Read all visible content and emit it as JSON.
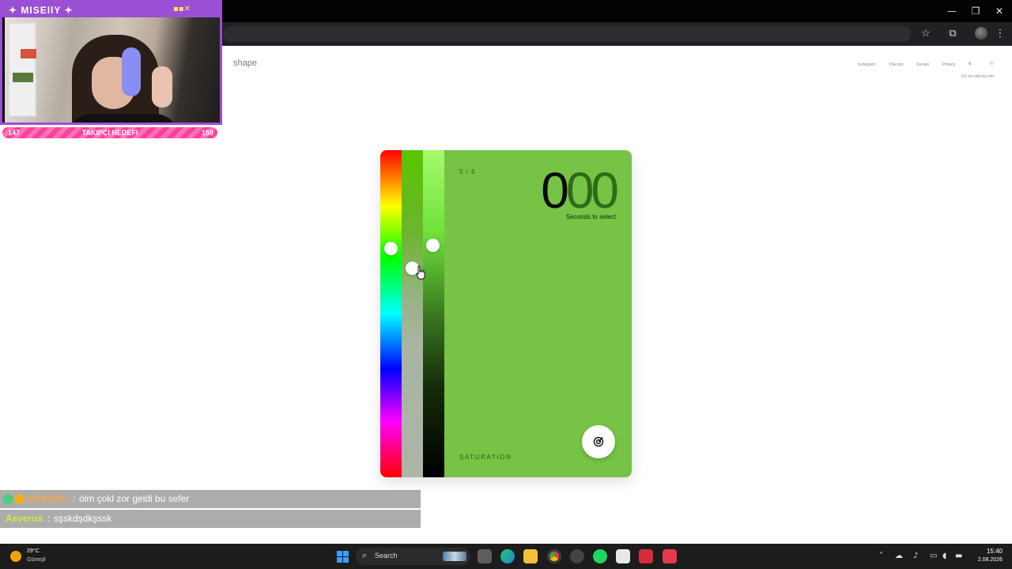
{
  "browser": {
    "minimize": "—",
    "maximize": "❐",
    "close": "✕",
    "star_icon": "star-icon",
    "extensions_icon": "puzzle-icon",
    "menu_icon": "more-vert-icon"
  },
  "site": {
    "brand": "shape",
    "nav": [
      "Instagram",
      "Discord",
      "Socials",
      "Privacy"
    ],
    "sub_link": "Do not sell my info",
    "sound_icon": "speaker-icon",
    "theme_icon": "sun-icon"
  },
  "game": {
    "round": "5 / 5",
    "timer_first": "0",
    "timer_rest": "00",
    "timer_label": "Seconds to select",
    "mode_label": "SATURATION",
    "target_color": "#76c346",
    "submit_icon": "target-icon",
    "hue_position": 0.3,
    "saturation_position": 0.36,
    "lightness_position": 0.29
  },
  "stream": {
    "streamer_name": "✦ MISEllY ✦",
    "follower_goal": {
      "current": "147",
      "label": "TAKIPÇI HEDEFI",
      "target": "150"
    },
    "accent": "#9b4fd4"
  },
  "chat": [
    {
      "user": "NullV0id",
      "sep": ":",
      "message": "olm çokl zor geldi bu sefer",
      "user_color": "#f5a742"
    },
    {
      "user": "Asverus",
      "sep": ":",
      "message": "sşskdşdkşssk",
      "user_color": "#c8f03c"
    }
  ],
  "taskbar": {
    "weather_temp": "29°C",
    "weather_desc": "Güneşli",
    "search_label": "Search",
    "time": "15:40",
    "date": "2.08.2026"
  }
}
